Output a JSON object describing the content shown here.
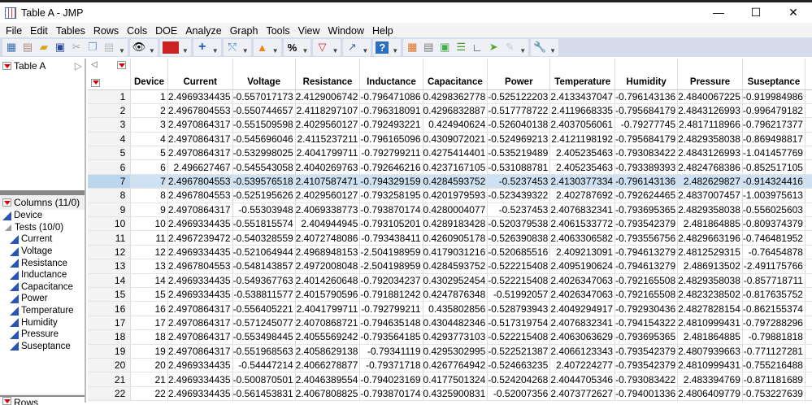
{
  "window": {
    "title": "Table A - JMP",
    "minimize": "—",
    "maximize": "☐",
    "close": "✕"
  },
  "menu": [
    "File",
    "Edit",
    "Tables",
    "Rows",
    "Cols",
    "DOE",
    "Analyze",
    "Graph",
    "Tools",
    "View",
    "Window",
    "Help"
  ],
  "toolbar_icons": [
    "new-data-table-icon",
    "new-script-icon",
    "open-icon",
    "save-icon",
    "cut-icon",
    "copy-icon",
    "paste-icon",
    "eye-icon",
    "jsl-icon",
    "crosshair-icon",
    "lasso-icon",
    "triangle-icon",
    "percent-icon",
    "filter-icon",
    "graph-builder-icon",
    "help-icon",
    "data-table-icon",
    "calculator-icon",
    "layout-icon",
    "bar-icon",
    "fit-icon",
    "arrow-icon",
    "edit-icon",
    "wrench-icon"
  ],
  "left": {
    "table_name": "Table A",
    "columns_header": "Columns (11/0)",
    "device": "Device",
    "group": "Tests (10/0)",
    "columns": [
      "Current",
      "Voltage",
      "Resistance",
      "Inductance",
      "Capacitance",
      "Power",
      "Temperature",
      "Humidity",
      "Pressure",
      "Suseptance"
    ],
    "rows_header": "Rows"
  },
  "table": {
    "headers": [
      "Device",
      "Current",
      "Voltage",
      "Resistance",
      "Inductance",
      "Capacitance",
      "Power",
      "Temperature",
      "Humidity",
      "Pressure",
      "Suseptance"
    ],
    "selected_row": 7,
    "rows": [
      [
        "1",
        "2.4969334435",
        "-0.557017173",
        "2.4129006742",
        "-0.796471086",
        "0.4298362778",
        "-0.525122203",
        "2.4133437047",
        "-0.796143136",
        "2.4840067225",
        "-0.919984986"
      ],
      [
        "2",
        "2.4967804553",
        "-0.550744657",
        "2.4118297107",
        "-0.796318091",
        "0.4296832887",
        "-0.517778722",
        "2.4119668335",
        "-0.795684179",
        "2.4843126993",
        "-0.996479182"
      ],
      [
        "3",
        "2.4970864317",
        "-0.551509598",
        "2.4029560127",
        "-0.792493221",
        "0.424940624",
        "-0.526040138",
        "2.4037056061",
        "-0.79277745",
        "2.4817118966",
        "-0.796217377"
      ],
      [
        "4",
        "2.4970864317",
        "-0.545696046",
        "2.4115237211",
        "-0.796165096",
        "0.4309072021",
        "-0.524969213",
        "2.4121198192",
        "-0.795684179",
        "2.4829358038",
        "-0.869498817"
      ],
      [
        "5",
        "2.4970864317",
        "-0.532998025",
        "2.4041799711",
        "-0.792799211",
        "0.4275414401",
        "-0.535219489",
        "2.405235463",
        "-0.793083422",
        "2.4843126993",
        "-1.041457769"
      ],
      [
        "6",
        "2.496627467",
        "-0.545543058",
        "2.4040269763",
        "-0.792646216",
        "0.4237167105",
        "-0.531088781",
        "2.405235463",
        "-0.793389393",
        "2.4824768386",
        "-0.852517105"
      ],
      [
        "7",
        "2.4967804553",
        "-0.539576518",
        "2.4107587471",
        "-0.794329159",
        "0.4284593752",
        "-0.5237453",
        "2.4130377334",
        "-0.796143136",
        "2.482629827",
        "-0.914324416"
      ],
      [
        "8",
        "2.4967804553",
        "-0.525195626",
        "2.4029560127",
        "-0.793258195",
        "0.4201979593",
        "-0.523439322",
        "2.402787692",
        "-0.792624465",
        "2.4837007457",
        "-1.003975613"
      ],
      [
        "9",
        "2.4970864317",
        "-0.55303948",
        "2.4069338773",
        "-0.793870174",
        "0.4280004077",
        "-0.5237453",
        "2.4076832341",
        "-0.793695365",
        "2.4829358038",
        "-0.556025603"
      ],
      [
        "10",
        "2.4969334435",
        "-0.551815574",
        "2.404944945",
        "-0.793105201",
        "0.4289183428",
        "-0.520379538",
        "2.4061533772",
        "-0.793542379",
        "2.481864885",
        "-0.809374379"
      ],
      [
        "11",
        "2.4967239472",
        "-0.540328559",
        "2.4072748086",
        "-0.793438411",
        "0.4260905178",
        "-0.526390838",
        "2.4063306582",
        "-0.793556756",
        "2.4829663196",
        "-0.746481952"
      ],
      [
        "12",
        "2.4969334435",
        "-0.521064944",
        "2.4968948153",
        "-2.504198959",
        "0.4179031216",
        "-0.520685516",
        "2.409213091",
        "-0.794613279",
        "2.4812529315",
        "-0.76454878"
      ],
      [
        "13",
        "2.4967804553",
        "-0.548143857",
        "2.4972008048",
        "-2.504198959",
        "0.4284593752",
        "-0.522215408",
        "2.4095190624",
        "-0.794613279",
        "2.486913502",
        "-2.491175766"
      ],
      [
        "14",
        "2.4969334435",
        "-0.549367763",
        "2.4014260648",
        "-0.792034237",
        "0.4302952454",
        "-0.522215408",
        "2.4026347063",
        "-0.792165508",
        "2.4829358038",
        "-0.857718711"
      ],
      [
        "15",
        "2.4969334435",
        "-0.538811577",
        "2.4015790596",
        "-0.791881242",
        "0.4247876348",
        "-0.51992057",
        "2.4026347063",
        "-0.792165508",
        "2.4823238502",
        "-0.817635752"
      ],
      [
        "16",
        "2.4970864317",
        "-0.556405221",
        "2.4041799711",
        "-0.792799211",
        "0.435802856",
        "-0.528793943",
        "2.4049294917",
        "-0.792930436",
        "2.4827828154",
        "-0.862155374"
      ],
      [
        "17",
        "2.4970864317",
        "-0.571245077",
        "2.4070868721",
        "-0.794635148",
        "0.4304482346",
        "-0.517319754",
        "2.4076832341",
        "-0.794154322",
        "2.4810999431",
        "-0.797288296"
      ],
      [
        "18",
        "2.4970864317",
        "-0.553498445",
        "2.4055569242",
        "-0.793564185",
        "0.4293773103",
        "-0.522215408",
        "2.4063063629",
        "-0.793695365",
        "2.481864885",
        "-0.79881818"
      ],
      [
        "19",
        "2.4970864317",
        "-0.551968563",
        "2.4058629138",
        "-0.79341119",
        "0.4295302995",
        "-0.522521387",
        "2.4066123343",
        "-0.793542379",
        "2.4807939663",
        "-0.771127281"
      ],
      [
        "20",
        "2.4969334435",
        "-0.54447214",
        "2.4066278877",
        "-0.79371718",
        "0.4267764942",
        "-0.524663235",
        "2.407224277",
        "-0.793542379",
        "2.4810999431",
        "-0.755216488"
      ],
      [
        "21",
        "2.4969334435",
        "-0.500870501",
        "2.4046389554",
        "-0.794023169",
        "0.4177501324",
        "-0.524204268",
        "2.4044705346",
        "-0.793083422",
        "2.483394769",
        "-0.871181689"
      ],
      [
        "22",
        "2.4969334435",
        "-0.561453831",
        "2.4067808825",
        "-0.793870174",
        "0.4325900831",
        "-0.52007356",
        "2.4073772627",
        "-0.794001336",
        "2.4806409779",
        "-0.753227639"
      ]
    ]
  },
  "colors": {
    "selection": "#cfe2f3",
    "toolbar": "#d5dbea",
    "column_icon": "#2855b5"
  }
}
